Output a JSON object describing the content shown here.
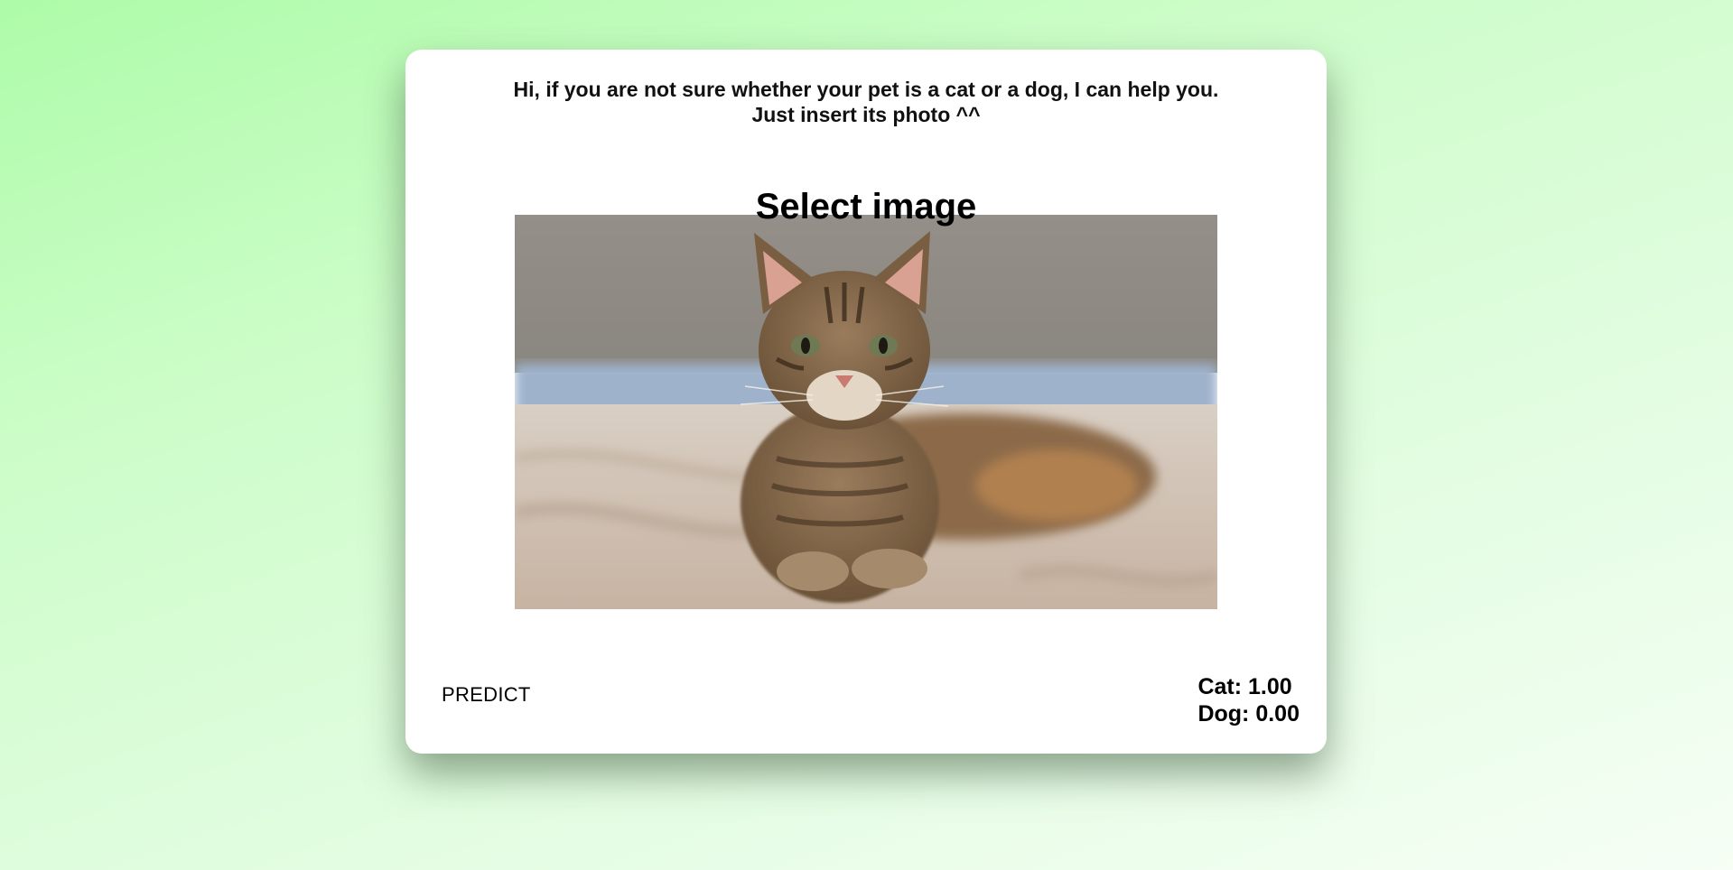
{
  "intro": {
    "line1": "Hi, if you are not sure whether your pet is a cat or a dog, I can help you.",
    "line2": "Just insert its photo ^^"
  },
  "upload": {
    "title": "Select image",
    "preview_subject": "tabby cat lying on a bed"
  },
  "actions": {
    "predict_label": "PREDICT"
  },
  "results": {
    "cat_label": "Cat:",
    "cat_score": "1.00",
    "dog_label": "Dog:",
    "dog_score": "0.00"
  },
  "colors": {
    "background_start": "#adfca9",
    "background_end": "#f6fef5",
    "card": "#ffffff",
    "text": "#111111"
  }
}
